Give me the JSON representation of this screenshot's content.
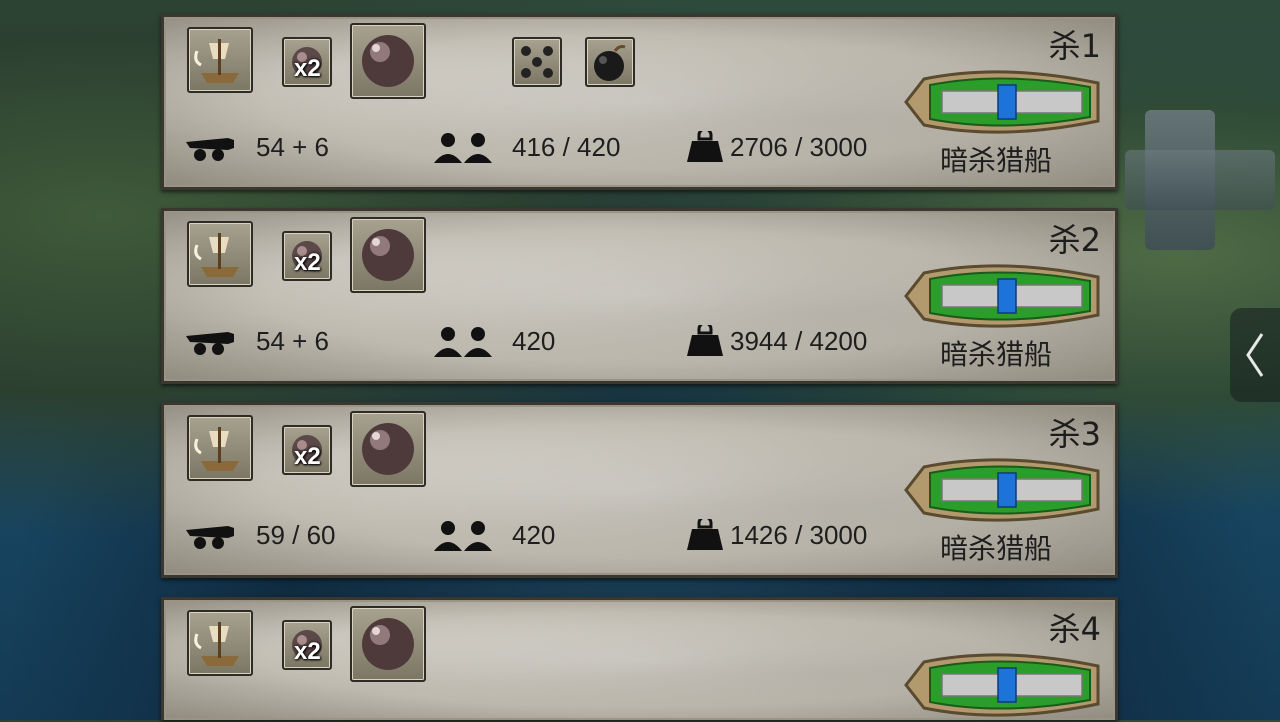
{
  "side_toggle": {
    "icon": "chevron-left-icon"
  },
  "panels": [
    {
      "kill_label": "杀1",
      "ship_type": "暗杀猎船",
      "ammo_multiplier": "x2",
      "guns": "54 + 6",
      "crew": "416 / 420",
      "cargo": "2706 / 3000",
      "extra_icons": [
        "grapeshot-icon",
        "bomb-icon"
      ]
    },
    {
      "kill_label": "杀2",
      "ship_type": "暗杀猎船",
      "ammo_multiplier": "x2",
      "guns": "54 + 6",
      "crew": "420",
      "cargo": "3944 / 4200"
    },
    {
      "kill_label": "杀3",
      "ship_type": "暗杀猎船",
      "ammo_multiplier": "x2",
      "guns": "59 / 60",
      "crew": "420",
      "cargo": "1426 / 3000"
    },
    {
      "kill_label": "杀4",
      "ship_type": "",
      "ammo_multiplier": "x2",
      "guns": "",
      "crew": "",
      "cargo": ""
    }
  ]
}
